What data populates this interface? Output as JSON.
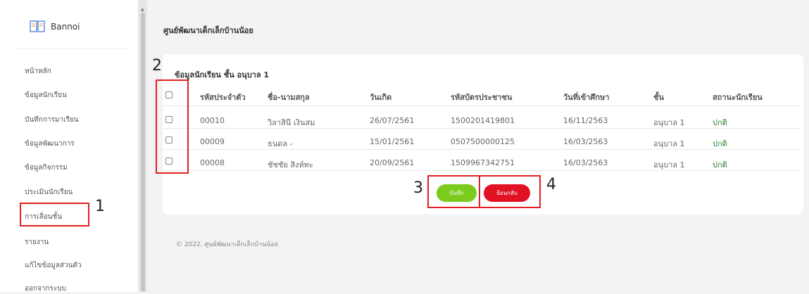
{
  "brand": {
    "name": "Bannoi",
    "icon": "book-icon"
  },
  "nav": {
    "items": [
      {
        "label": "หน้าหลัก"
      },
      {
        "label": "ข้อมูลนักเรียน"
      },
      {
        "label": "บันทึกการมาเรียน"
      },
      {
        "label": "ข้อมูลพัฒนาการ"
      },
      {
        "label": "ข้อมูลกิจกรรม"
      },
      {
        "label": "ประเมินนักเรียน"
      },
      {
        "label": "การเลื่อนชั้น"
      },
      {
        "label": "รายงาน"
      },
      {
        "label": "แก้ไขข้อมูลส่วนตัว"
      },
      {
        "label": "ออกจากระบบ"
      }
    ]
  },
  "page": {
    "title": "ศูนย์พัฒนาเด็กเล็กบ้านน้อย"
  },
  "card": {
    "title": "ข้อมูลนักเรียน ชั้น อนุบาล 1",
    "headers": [
      "รหัสประจำตัว",
      "ชื่อ-นามสกุล",
      "วันเกิด",
      "รหัสบัตรประชาชน",
      "วันที่เข้าศึกษา",
      "ชั้น",
      "สถานะนักเรียน"
    ],
    "rows": [
      [
        "00010",
        "วิลาสินี เงินสม",
        "26/07/2561",
        "1500201419801",
        "16/11/2563",
        "อนุบาล 1",
        "ปกติ"
      ],
      [
        "00009",
        "ธนดล -",
        "15/01/2561",
        "0507500000125",
        "16/03/2563",
        "อนุบาล 1",
        "ปกติ"
      ],
      [
        "00008",
        "ชัชชัย สิงห์ทะ",
        "20/09/2561",
        "1509967342751",
        "16/03/2563",
        "อนุบาล 1",
        "ปกติ"
      ]
    ]
  },
  "buttons": {
    "save": "บันทึก",
    "back": "ย้อนกลับ"
  },
  "annotations": [
    "1",
    "2",
    "3",
    "4"
  ],
  "footer": "© 2022, ศูนย์พัฒนาเด็กเล็กบ้านน้อย",
  "colors": {
    "save": "#7bcb1c",
    "back": "#e01224",
    "status": "#2e7d32",
    "annotation": "#e0201e"
  }
}
